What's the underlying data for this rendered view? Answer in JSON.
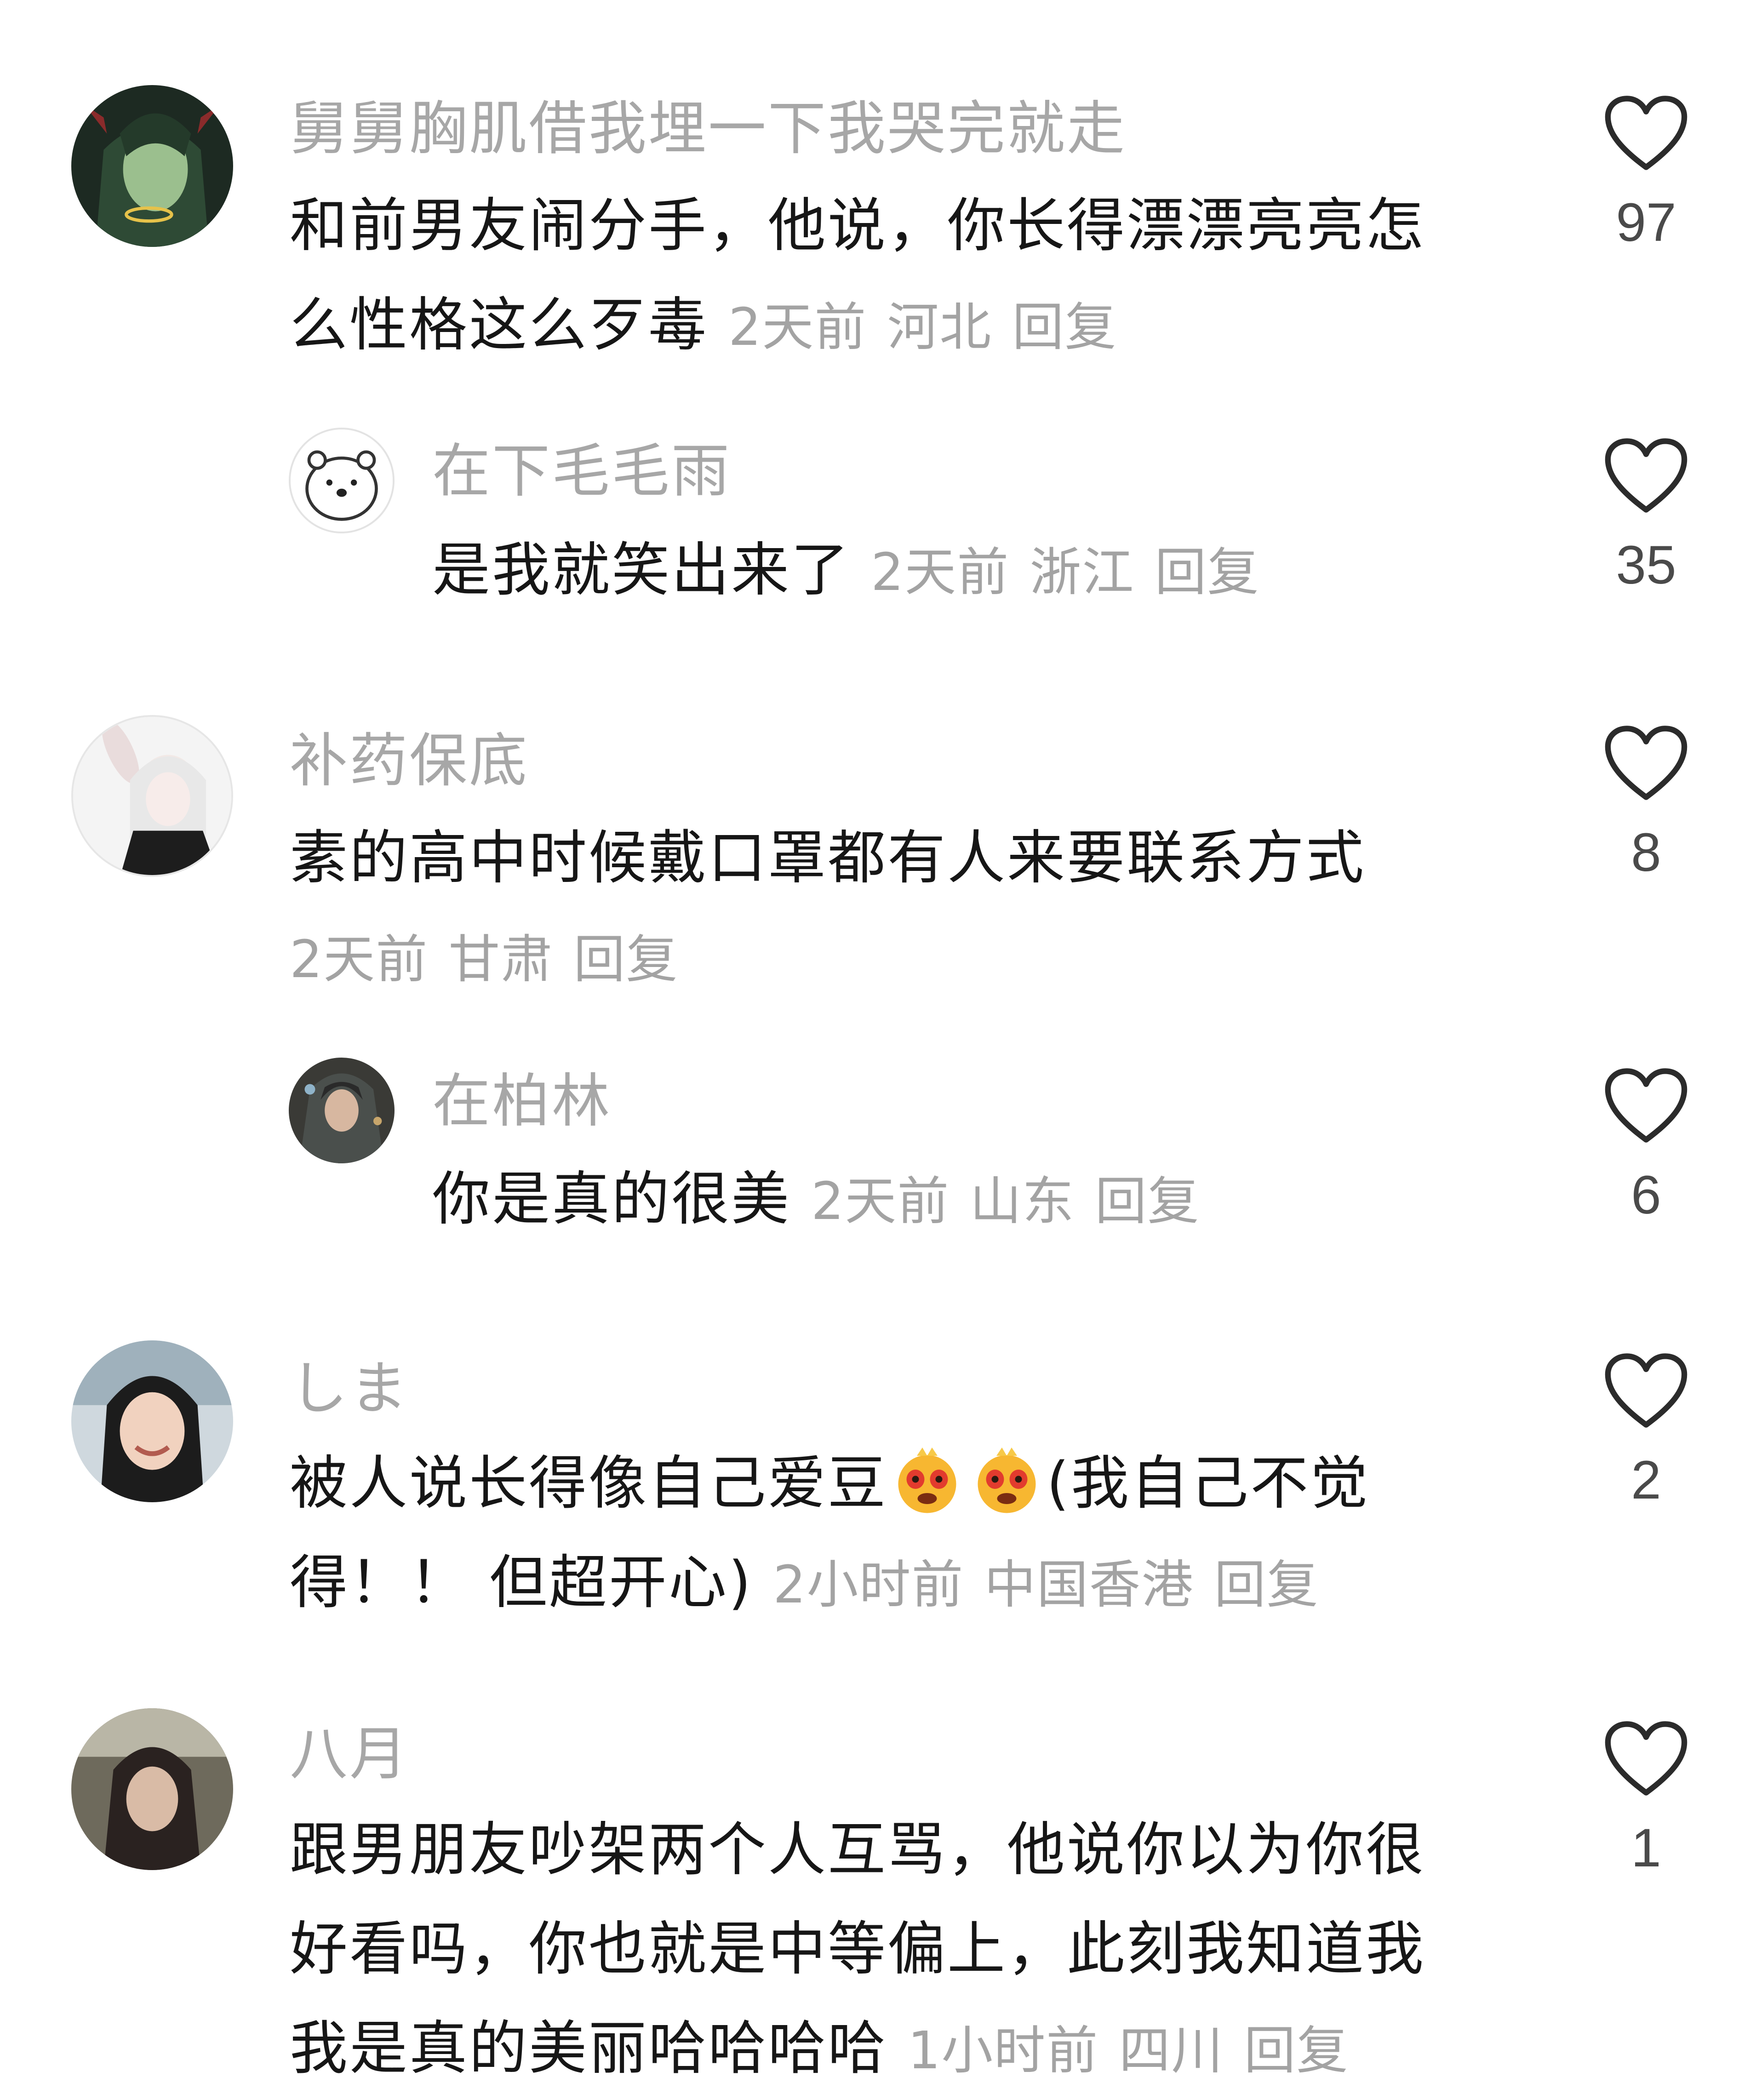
{
  "comments": [
    {
      "username": "舅舅胸肌借我埋一下我哭完就走",
      "line1": "和前男友闹分手，他说，你长得漂漂亮亮怎",
      "line2": "么性格这么歹毒",
      "time": "2天前",
      "location": "河北",
      "reply": "回复",
      "likes": "97"
    },
    {
      "username": "在下毛毛雨",
      "line1": "是我就笑出来了",
      "time": "2天前",
      "location": "浙江",
      "reply": "回复",
      "likes": "35"
    },
    {
      "username": "补药保底",
      "line1": "素的高中时候戴口罩都有人来要联系方式",
      "time": "2天前",
      "location": "甘肃",
      "reply": "回复",
      "likes": "8"
    },
    {
      "username": "在柏林",
      "line1": "你是真的很美",
      "time": "2天前",
      "location": "山东",
      "reply": "回复",
      "likes": "6"
    },
    {
      "username": "しま",
      "line1a": "被人说长得像自己爱豆",
      "line1b": "(我自己不觉",
      "line2": "得！！ 但超开心)",
      "time": "2小时前",
      "location": "中国香港",
      "reply": "回复",
      "likes": "2",
      "emojis": [
        "starstruck-emoji",
        "starstruck-emoji"
      ]
    },
    {
      "username": "八月",
      "line1": "跟男朋友吵架两个人互骂，他说你以为你很",
      "line2": "好看吗，你也就是中等偏上，此刻我知道我",
      "line3": "我是真的美丽哈哈哈哈",
      "time": "1小时前",
      "location": "四川",
      "reply": "回复",
      "likes": "1"
    }
  ],
  "icons": {
    "like": "heart-outline-icon"
  },
  "colors": {
    "username": "#a7a7a7",
    "text": "#161616",
    "meta": "#a3a3a3",
    "count": "#4a4a4a"
  }
}
